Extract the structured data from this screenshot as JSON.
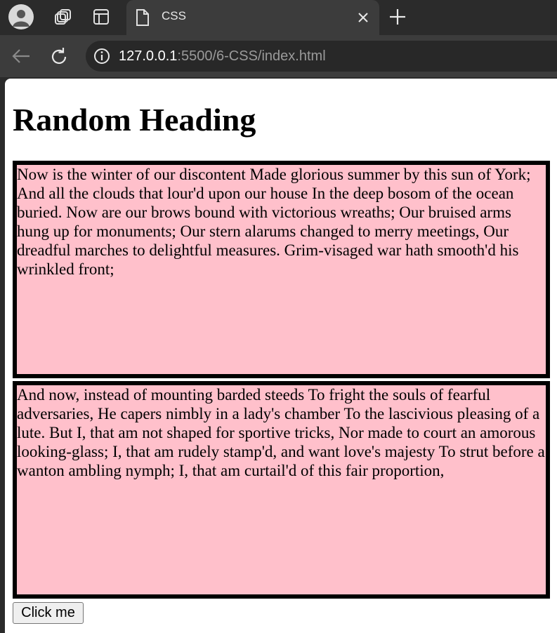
{
  "browser": {
    "tab_title": "CSS",
    "url_host": "127.0.0.1",
    "url_rest": ":5500/6-CSS/index.html",
    "icons": {
      "profile": "profile-icon",
      "workspaces": "workspaces-icon",
      "tab_actions": "tab-actions-icon",
      "page": "page-icon",
      "close": "close-icon",
      "new_tab": "plus-icon",
      "back": "back-arrow-icon",
      "reload": "reload-icon",
      "site_info": "info-icon"
    }
  },
  "page": {
    "heading": "Random Heading",
    "paragraph_1": "Now is the winter of our discontent Made glorious summer by this sun of York; And all the clouds that lour'd upon our house In the deep bosom of the ocean buried. Now are our brows bound with victorious wreaths; Our bruised arms hung up for monuments; Our stern alarums changed to merry meetings, Our dreadful marches to delightful measures. Grim-visaged war hath smooth'd his wrinkled front;",
    "paragraph_2": "And now, instead of mounting barded steeds To fright the souls of fearful adversaries, He capers nimbly in a lady's chamber To the lascivious pleasing of a lute. But I, that am not shaped for sportive tricks, Nor made to court an amorous looking-glass; I, that am rudely stamp'd, and want love's majesty To strut before a wanton ambling nymph; I, that am curtail'd of this fair proportion,",
    "button_label": "Click me"
  },
  "colors": {
    "paragraph_background": "#ffc0cb",
    "paragraph_border": "#000000",
    "browser_chrome": "#2b2b2b",
    "toolbar": "#3c3c3c"
  }
}
